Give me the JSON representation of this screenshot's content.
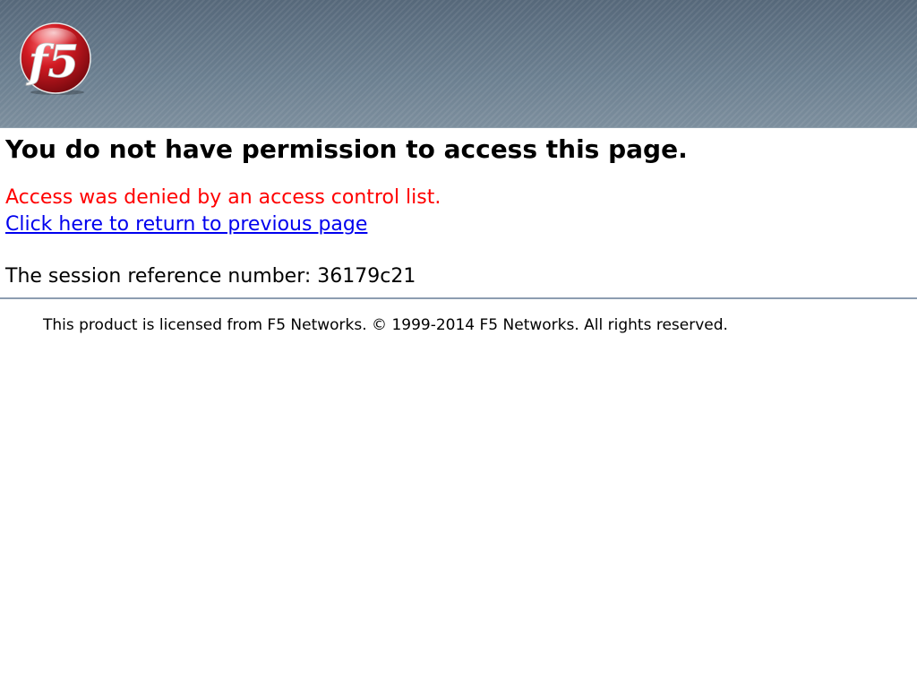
{
  "header": {
    "logo_text": "f5",
    "logo_icon": "f5-logo-icon"
  },
  "main": {
    "title": "You do not have permission to access this page.",
    "error_message": "Access was denied by an access control list.",
    "back_link_label": "Click here to return to previous page",
    "session_label": "The session reference number: ",
    "session_id": "36179c21"
  },
  "footer": {
    "text": "This product is licensed from F5 Networks. © 1999-2014 F5 Networks. All rights reserved."
  },
  "colors": {
    "error": "#ff0000",
    "link": "#0000ee",
    "banner": "#647889",
    "logo_red": "#d01a22"
  }
}
